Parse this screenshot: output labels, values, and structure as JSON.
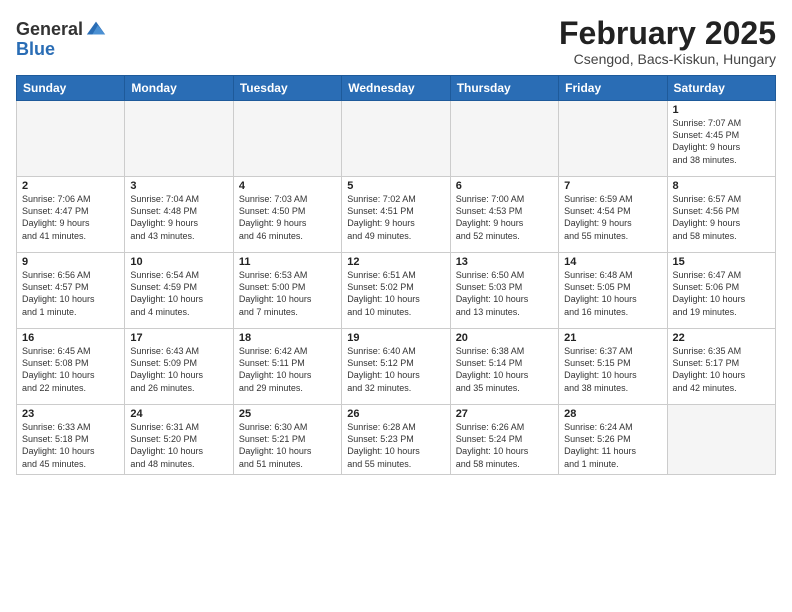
{
  "header": {
    "logo_general": "General",
    "logo_blue": "Blue",
    "month_title": "February 2025",
    "location": "Csengod, Bacs-Kiskun, Hungary"
  },
  "weekdays": [
    "Sunday",
    "Monday",
    "Tuesday",
    "Wednesday",
    "Thursday",
    "Friday",
    "Saturday"
  ],
  "weeks": [
    [
      {
        "day": "",
        "info": ""
      },
      {
        "day": "",
        "info": ""
      },
      {
        "day": "",
        "info": ""
      },
      {
        "day": "",
        "info": ""
      },
      {
        "day": "",
        "info": ""
      },
      {
        "day": "",
        "info": ""
      },
      {
        "day": "1",
        "info": "Sunrise: 7:07 AM\nSunset: 4:45 PM\nDaylight: 9 hours\nand 38 minutes."
      }
    ],
    [
      {
        "day": "2",
        "info": "Sunrise: 7:06 AM\nSunset: 4:47 PM\nDaylight: 9 hours\nand 41 minutes."
      },
      {
        "day": "3",
        "info": "Sunrise: 7:04 AM\nSunset: 4:48 PM\nDaylight: 9 hours\nand 43 minutes."
      },
      {
        "day": "4",
        "info": "Sunrise: 7:03 AM\nSunset: 4:50 PM\nDaylight: 9 hours\nand 46 minutes."
      },
      {
        "day": "5",
        "info": "Sunrise: 7:02 AM\nSunset: 4:51 PM\nDaylight: 9 hours\nand 49 minutes."
      },
      {
        "day": "6",
        "info": "Sunrise: 7:00 AM\nSunset: 4:53 PM\nDaylight: 9 hours\nand 52 minutes."
      },
      {
        "day": "7",
        "info": "Sunrise: 6:59 AM\nSunset: 4:54 PM\nDaylight: 9 hours\nand 55 minutes."
      },
      {
        "day": "8",
        "info": "Sunrise: 6:57 AM\nSunset: 4:56 PM\nDaylight: 9 hours\nand 58 minutes."
      }
    ],
    [
      {
        "day": "9",
        "info": "Sunrise: 6:56 AM\nSunset: 4:57 PM\nDaylight: 10 hours\nand 1 minute."
      },
      {
        "day": "10",
        "info": "Sunrise: 6:54 AM\nSunset: 4:59 PM\nDaylight: 10 hours\nand 4 minutes."
      },
      {
        "day": "11",
        "info": "Sunrise: 6:53 AM\nSunset: 5:00 PM\nDaylight: 10 hours\nand 7 minutes."
      },
      {
        "day": "12",
        "info": "Sunrise: 6:51 AM\nSunset: 5:02 PM\nDaylight: 10 hours\nand 10 minutes."
      },
      {
        "day": "13",
        "info": "Sunrise: 6:50 AM\nSunset: 5:03 PM\nDaylight: 10 hours\nand 13 minutes."
      },
      {
        "day": "14",
        "info": "Sunrise: 6:48 AM\nSunset: 5:05 PM\nDaylight: 10 hours\nand 16 minutes."
      },
      {
        "day": "15",
        "info": "Sunrise: 6:47 AM\nSunset: 5:06 PM\nDaylight: 10 hours\nand 19 minutes."
      }
    ],
    [
      {
        "day": "16",
        "info": "Sunrise: 6:45 AM\nSunset: 5:08 PM\nDaylight: 10 hours\nand 22 minutes."
      },
      {
        "day": "17",
        "info": "Sunrise: 6:43 AM\nSunset: 5:09 PM\nDaylight: 10 hours\nand 26 minutes."
      },
      {
        "day": "18",
        "info": "Sunrise: 6:42 AM\nSunset: 5:11 PM\nDaylight: 10 hours\nand 29 minutes."
      },
      {
        "day": "19",
        "info": "Sunrise: 6:40 AM\nSunset: 5:12 PM\nDaylight: 10 hours\nand 32 minutes."
      },
      {
        "day": "20",
        "info": "Sunrise: 6:38 AM\nSunset: 5:14 PM\nDaylight: 10 hours\nand 35 minutes."
      },
      {
        "day": "21",
        "info": "Sunrise: 6:37 AM\nSunset: 5:15 PM\nDaylight: 10 hours\nand 38 minutes."
      },
      {
        "day": "22",
        "info": "Sunrise: 6:35 AM\nSunset: 5:17 PM\nDaylight: 10 hours\nand 42 minutes."
      }
    ],
    [
      {
        "day": "23",
        "info": "Sunrise: 6:33 AM\nSunset: 5:18 PM\nDaylight: 10 hours\nand 45 minutes."
      },
      {
        "day": "24",
        "info": "Sunrise: 6:31 AM\nSunset: 5:20 PM\nDaylight: 10 hours\nand 48 minutes."
      },
      {
        "day": "25",
        "info": "Sunrise: 6:30 AM\nSunset: 5:21 PM\nDaylight: 10 hours\nand 51 minutes."
      },
      {
        "day": "26",
        "info": "Sunrise: 6:28 AM\nSunset: 5:23 PM\nDaylight: 10 hours\nand 55 minutes."
      },
      {
        "day": "27",
        "info": "Sunrise: 6:26 AM\nSunset: 5:24 PM\nDaylight: 10 hours\nand 58 minutes."
      },
      {
        "day": "28",
        "info": "Sunrise: 6:24 AM\nSunset: 5:26 PM\nDaylight: 11 hours\nand 1 minute."
      },
      {
        "day": "",
        "info": ""
      }
    ]
  ]
}
